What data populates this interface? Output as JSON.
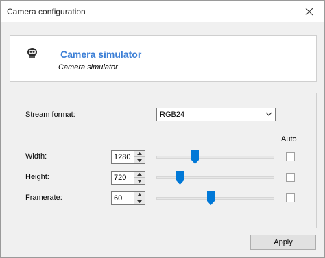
{
  "window": {
    "title": "Camera configuration"
  },
  "device": {
    "name": "Camera simulator",
    "subtitle": "Camera simulator"
  },
  "stream_format": {
    "label": "Stream format:",
    "value": "RGB24"
  },
  "auto_label": "Auto",
  "fields": [
    {
      "label": "Width:",
      "value": "1280",
      "slider_fraction": 0.33,
      "auto": false
    },
    {
      "label": "Height:",
      "value": "720",
      "slider_fraction": 0.2,
      "auto": false
    },
    {
      "label": "Framerate:",
      "value": "60",
      "slider_fraction": 0.46,
      "auto": false
    }
  ],
  "apply_label": "Apply",
  "colors": {
    "accent": "#3c7fd6",
    "slider_thumb": "#0078d7"
  },
  "icons": {
    "close": "close-icon",
    "camera": "webcam-icon",
    "dropdown": "chevron-down-icon"
  }
}
